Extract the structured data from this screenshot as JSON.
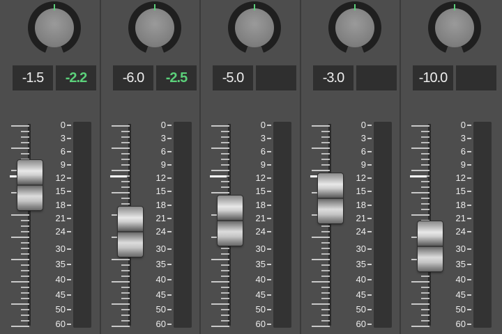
{
  "mixer": {
    "accent_color": "#5bd07a",
    "scale_labels": [
      "0",
      "3",
      "6",
      "9",
      "12",
      "15",
      "18",
      "21",
      "24",
      "30",
      "35",
      "40",
      "45",
      "50",
      "60"
    ],
    "channels": [
      {
        "knob_icon": "pan-knob-icon",
        "volume": "-1.5",
        "peak": "-2.2",
        "fader_db": 13.5
      },
      {
        "knob_icon": "pan-knob-icon",
        "volume": "-6.0",
        "peak": "-2.5",
        "fader_db": 24
      },
      {
        "knob_icon": "pan-knob-icon",
        "volume": "-5.0",
        "peak": "",
        "fader_db": 21.5
      },
      {
        "knob_icon": "pan-knob-icon",
        "volume": "-3.0",
        "peak": "",
        "fader_db": 16.5
      },
      {
        "knob_icon": "pan-knob-icon",
        "volume": "-10.0",
        "peak": "",
        "fader_db": 29
      }
    ]
  }
}
